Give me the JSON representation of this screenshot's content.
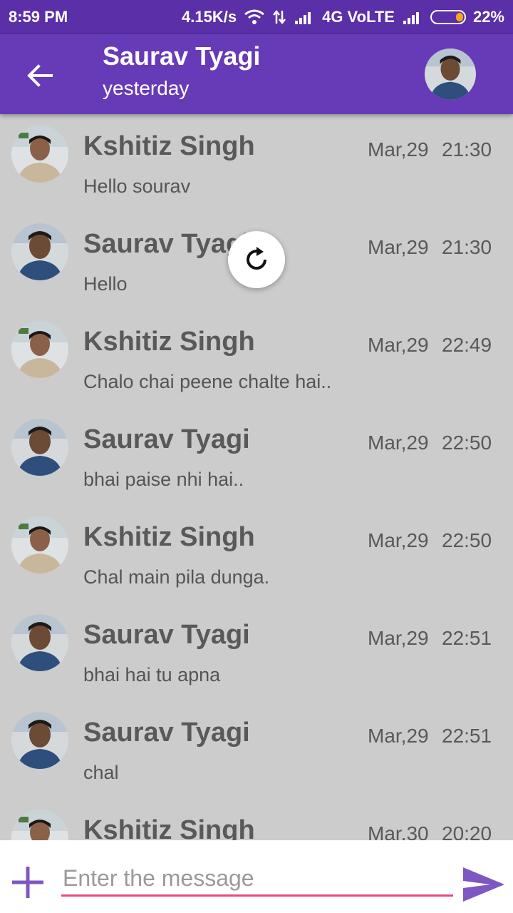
{
  "status_bar": {
    "time": "8:59 PM",
    "network_speed": "4.15K/s",
    "network_type": "4G VoLTE",
    "battery": "22%",
    "battery_level": 0.22,
    "icons": [
      "wifi-icon",
      "data-arrows-icon",
      "signal-icon",
      "signal-icon",
      "battery-icon"
    ]
  },
  "header": {
    "back_icon": "arrow-left-icon",
    "title": "Saurav Tyagi",
    "subtitle": "yesterday",
    "avatar": "avatar-saurav"
  },
  "messages": [
    {
      "sender": "Kshitiz Singh",
      "date": "Mar,29",
      "time": "21:30",
      "text": "Hello sourav",
      "avatar": "avatar-kshitiz"
    },
    {
      "sender": "Saurav Tyagi",
      "date": "Mar,29",
      "time": "21:30",
      "text": "Hello",
      "avatar": "avatar-saurav"
    },
    {
      "sender": "Kshitiz Singh",
      "date": "Mar,29",
      "time": "22:49",
      "text": "Chalo chai peene chalte hai..",
      "avatar": "avatar-kshitiz"
    },
    {
      "sender": "Saurav Tyagi",
      "date": "Mar,29",
      "time": "22:50",
      "text": "bhai paise nhi hai..",
      "avatar": "avatar-saurav"
    },
    {
      "sender": "Kshitiz Singh",
      "date": "Mar,29",
      "time": "22:50",
      "text": "Chal main pila dunga.",
      "avatar": "avatar-kshitiz"
    },
    {
      "sender": "Saurav Tyagi",
      "date": "Mar,29",
      "time": "22:51",
      "text": "bhai hai tu apna",
      "avatar": "avatar-saurav"
    },
    {
      "sender": "Saurav Tyagi",
      "date": "Mar,29",
      "time": "22:51",
      "text": "chal",
      "avatar": "avatar-saurav"
    },
    {
      "sender": "Kshitiz Singh",
      "date": "Mar,30",
      "time": "20:20",
      "text": "",
      "avatar": "avatar-kshitiz"
    }
  ],
  "refresh_icon": "refresh-icon",
  "input_bar": {
    "add_icon": "plus-icon",
    "placeholder": "Enter the message",
    "value": "",
    "send_icon": "send-icon"
  },
  "colors": {
    "status_bar": "#5b2fa8",
    "app_bar": "#673ab7",
    "accent_purple": "#7e57c2",
    "input_underline": "#e84a7f",
    "background": "#cccccc"
  }
}
